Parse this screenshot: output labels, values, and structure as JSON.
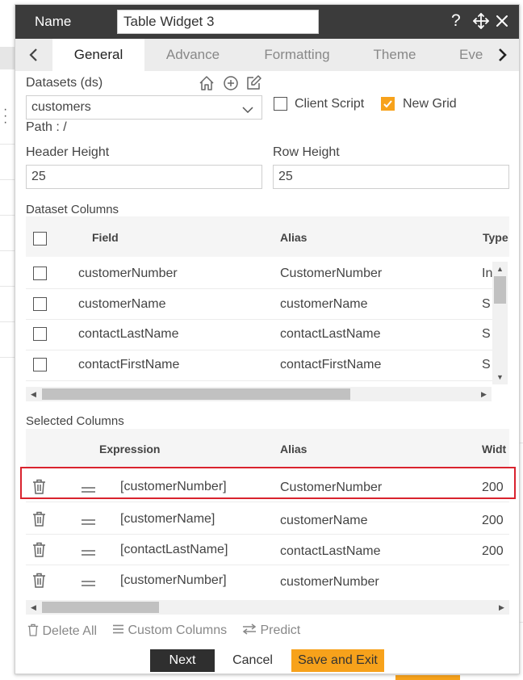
{
  "dialog": {
    "name_label": "Name",
    "name_value": "Table Widget 3",
    "icons": [
      "help-icon",
      "move-icon",
      "close-icon"
    ]
  },
  "tabs": [
    {
      "label": "General",
      "active": true
    },
    {
      "label": "Advance",
      "active": false
    },
    {
      "label": "Formatting",
      "active": false
    },
    {
      "label": "Theme",
      "active": false
    },
    {
      "label": "Eve",
      "active": false
    }
  ],
  "datasets": {
    "label": "Datasets (ds)",
    "selected": "customers",
    "path_label": "Path : /",
    "client_script_label": "Client Script",
    "client_script_checked": false,
    "new_grid_label": "New Grid",
    "new_grid_checked": true
  },
  "header_height": {
    "label": "Header Height",
    "value": "25"
  },
  "row_height": {
    "label": "Row Height",
    "value": "25"
  },
  "dataset_columns": {
    "title": "Dataset Columns",
    "headers": {
      "field": "Field",
      "alias": "Alias",
      "type": "Type"
    },
    "rows": [
      {
        "field": "customerNumber",
        "alias": "CustomerNumber",
        "type": "In"
      },
      {
        "field": "customerName",
        "alias": "customerName",
        "type": "S"
      },
      {
        "field": "contactLastName",
        "alias": "contactLastName",
        "type": "S"
      },
      {
        "field": "contactFirstName",
        "alias": "contactFirstName",
        "type": "S"
      }
    ]
  },
  "selected_columns": {
    "title": "Selected Columns",
    "headers": {
      "expression": "Expression",
      "alias": "Alias",
      "width": "Widt"
    },
    "rows": [
      {
        "expression": "[customerNumber]",
        "alias": "CustomerNumber",
        "width": "200"
      },
      {
        "expression": "[customerName]",
        "alias": "customerName",
        "width": "200"
      },
      {
        "expression": "[contactLastName]",
        "alias": "contactLastName",
        "width": "200"
      },
      {
        "expression": "[customerNumber]",
        "alias": "customerNumber",
        "width": ""
      }
    ]
  },
  "actions": {
    "delete_all": "Delete All",
    "custom_columns": "Custom Columns",
    "predict": "Predict"
  },
  "buttons": {
    "next": "Next",
    "cancel": "Cancel",
    "save_exit": "Save and Exit"
  },
  "colors": {
    "accent": "#f7a21b",
    "titlebar": "#3b3b3b",
    "highlight": "#d9232e"
  }
}
